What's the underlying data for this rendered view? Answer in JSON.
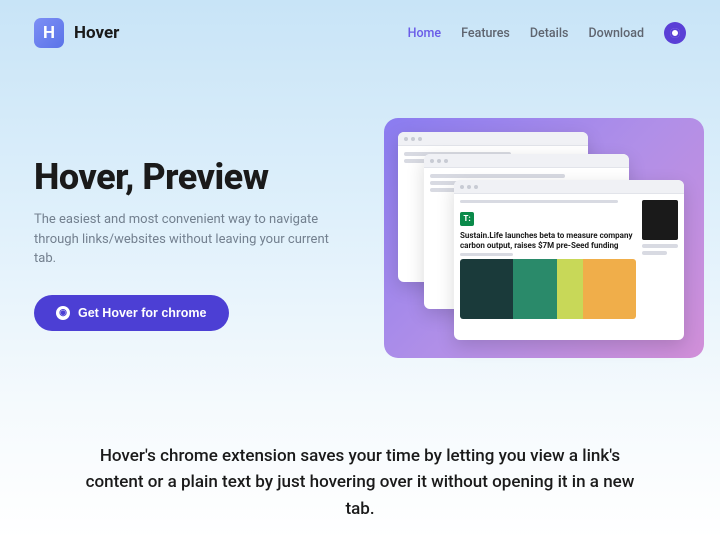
{
  "brand": {
    "logoLetter": "H",
    "name": "Hover"
  },
  "nav": {
    "items": [
      {
        "label": "Home",
        "active": true
      },
      {
        "label": "Features",
        "active": false
      },
      {
        "label": "Details",
        "active": false
      },
      {
        "label": "Download",
        "active": false
      }
    ]
  },
  "hero": {
    "title": "Hover, Preview",
    "subtitle": "The easiest and most convenient way to navigate through links/websites without leaving your current tab.",
    "cta": "Get Hover for chrome"
  },
  "preview": {
    "articleHeadline": "Sustain.Life launches beta to measure company carbon output, raises $7M pre-Seed funding",
    "tcLabel": "T:"
  },
  "tagline": "Hover's chrome extension saves your time by letting you view a link's content or a plain text by just hovering over it without opening it in a new tab."
}
